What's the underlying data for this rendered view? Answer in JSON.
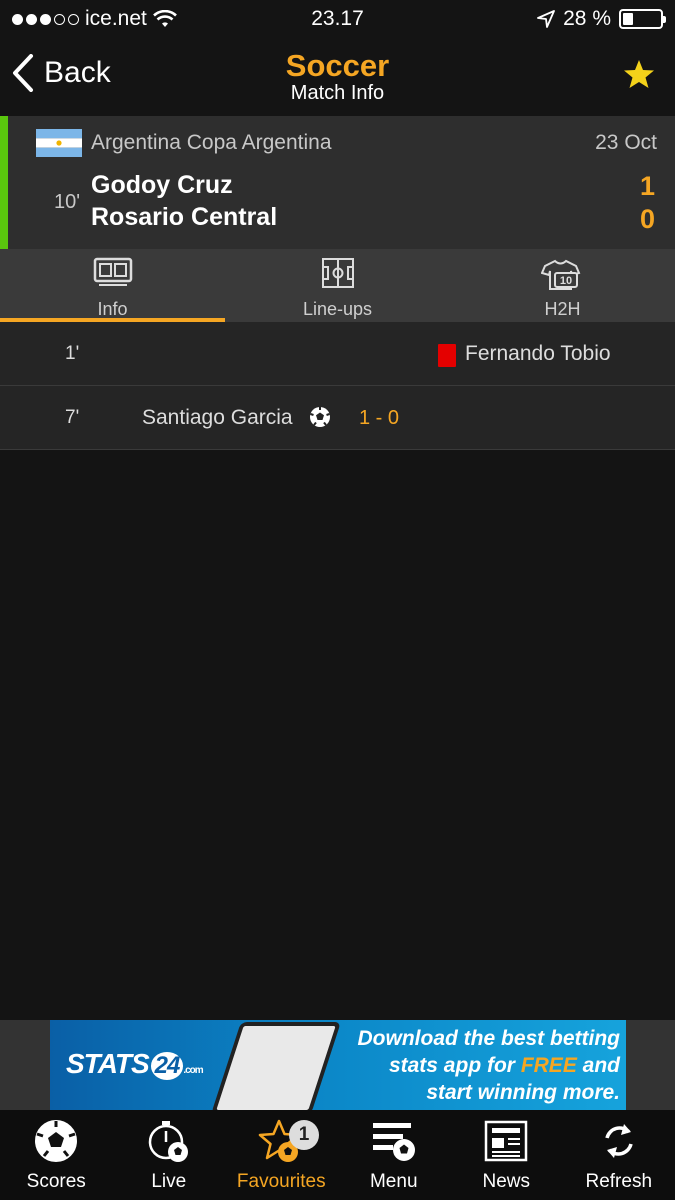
{
  "status_bar": {
    "carrier": "ice.net",
    "time": "23.17",
    "battery": "28 %",
    "battery_level": 0.28
  },
  "nav": {
    "back_label": "Back",
    "title": "Soccer",
    "subtitle": "Match Info"
  },
  "match": {
    "competition": "Argentina Copa Argentina",
    "date": "23 Oct",
    "minute": "10'",
    "home_team": "Godoy Cruz",
    "away_team": "Rosario Central",
    "home_score": "1",
    "away_score": "0"
  },
  "tabs": [
    {
      "label": "Info",
      "active": true
    },
    {
      "label": "Line-ups",
      "active": false
    },
    {
      "label": "H2H",
      "active": false
    }
  ],
  "events": [
    {
      "minute": "1'",
      "type": "red-card",
      "player": "Fernando Tobio",
      "side": "away"
    },
    {
      "minute": "7'",
      "type": "goal",
      "player": "Santiago Garcia",
      "side": "home",
      "score": "1 - 0"
    }
  ],
  "ad": {
    "brand": "STATS",
    "brand_number": "24",
    "brand_suffix": ".com",
    "line1": "Download the best betting",
    "line2_a": "stats app for ",
    "line2_highlight": "FREE",
    "line2_b": " and",
    "line3": "start winning more."
  },
  "tabbar": {
    "items": [
      {
        "label": "Scores",
        "icon": "soccer-ball-icon"
      },
      {
        "label": "Live",
        "icon": "stopwatch-ball-icon"
      },
      {
        "label": "Favourites",
        "icon": "star-ball-icon",
        "badge": "1",
        "active": true
      },
      {
        "label": "Menu",
        "icon": "menu-ball-icon"
      },
      {
        "label": "News",
        "icon": "newspaper-icon"
      },
      {
        "label": "Refresh",
        "icon": "refresh-icon"
      }
    ]
  },
  "colors": {
    "accent": "#f5a623",
    "live": "#5ac60e",
    "red_card": "#e40000",
    "background": "#141414"
  }
}
